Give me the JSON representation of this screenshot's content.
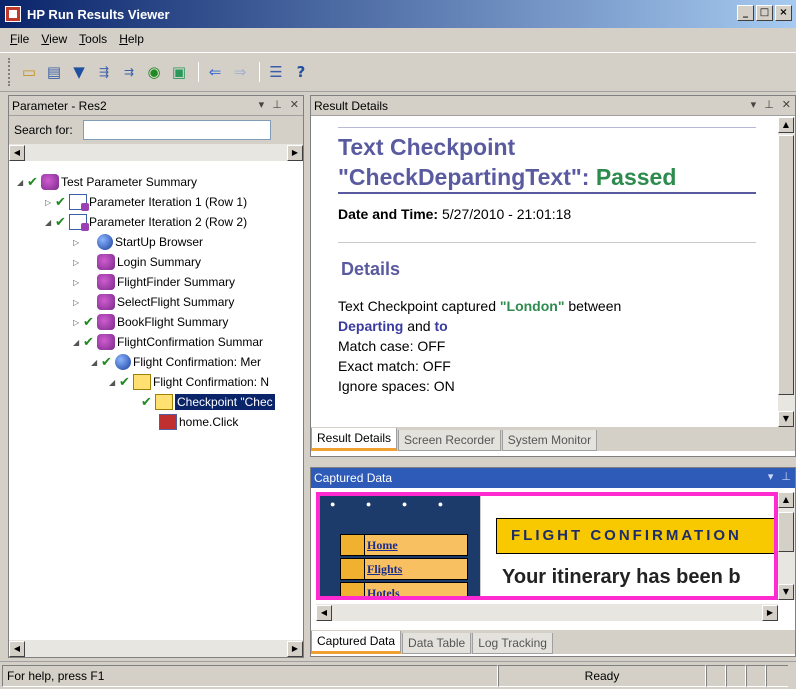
{
  "window": {
    "title": "HP Run Results Viewer",
    "buttons": [
      "_",
      "□",
      "×"
    ]
  },
  "menu": [
    {
      "label": "File",
      "key": "F",
      "rest": "ile"
    },
    {
      "label": "View",
      "key": "V",
      "rest": "iew"
    },
    {
      "label": "Tools",
      "key": "T",
      "rest": "ools"
    },
    {
      "label": "Help",
      "key": "H",
      "rest": "elp"
    }
  ],
  "toolbar": {
    "icons": [
      "open-icon",
      "print-icon",
      "filter-icon",
      "tree-expand-icon",
      "tree-collapse-icon",
      "refresh-icon",
      "export-icon",
      "back-icon",
      "forward-icon",
      "list-icon",
      "help-icon"
    ]
  },
  "left_panel": {
    "title": "Parameter - Res2",
    "search_label": "Search for:",
    "search_value": "",
    "tree": [
      {
        "label": "Test Parameter Summary",
        "expander": "◢",
        "check": true,
        "icon": "summary"
      },
      {
        "label": "Parameter Iteration 1 (Row 1)",
        "expander": "▷",
        "check": true,
        "icon": "doc"
      },
      {
        "label": "Parameter Iteration 2 (Row 2)",
        "expander": "◢",
        "check": true,
        "icon": "doc"
      },
      {
        "label": "StartUp Browser",
        "expander": "▷",
        "check": false,
        "icon": "globe"
      },
      {
        "label": "Login Summary",
        "expander": "▷",
        "check": false,
        "icon": "summary"
      },
      {
        "label": "FlightFinder Summary",
        "expander": "▷",
        "check": false,
        "icon": "summary"
      },
      {
        "label": "SelectFlight Summary",
        "expander": "▷",
        "check": false,
        "icon": "summary"
      },
      {
        "label": "BookFlight Summary",
        "expander": "▷",
        "check": true,
        "icon": "summary"
      },
      {
        "label": "FlightConfirmation Summar",
        "expander": "◢",
        "check": true,
        "icon": "summary"
      },
      {
        "label": "Flight Confirmation: Mer",
        "expander": "◢",
        "check": true,
        "icon": "globe"
      },
      {
        "label": "Flight Confirmation: N",
        "expander": "◢",
        "check": true,
        "icon": "step"
      },
      {
        "label": "Checkpoint \"Chec",
        "expander": "",
        "check": true,
        "icon": "step",
        "selected": true
      },
      {
        "label": "home.Click",
        "expander": "",
        "check": false,
        "icon": "click"
      }
    ]
  },
  "result_panel": {
    "title": "Result Details",
    "heading_line1": "Text Checkpoint",
    "heading_line2": "\"CheckDepartingText\":",
    "status": "Passed",
    "date_label": "Date and Time:",
    "date_value": "5/27/2010 - 21:01:18",
    "details_heading": "Details",
    "captured_text_prefix": "Text Checkpoint  captured",
    "captured_value": "\"London\"",
    "between_word": "between",
    "from_word": "Departing",
    "and_word": "and",
    "to_word": "to",
    "match_case": "Match case: OFF",
    "exact_match": "Exact match: OFF",
    "ignore_spaces": "Ignore spaces: ON",
    "tabs": [
      "Result Details",
      "Screen Recorder",
      "System Monitor"
    ],
    "active_tab": 0
  },
  "captured_panel": {
    "title": "Captured Data",
    "image": {
      "nav_links": [
        "Home",
        "Flights",
        "Hotels"
      ],
      "banner": "FLIGHT CONFIRMATION",
      "message": "Your itinerary has been b"
    },
    "tabs": [
      "Captured Data",
      "Data Table",
      "Log Tracking"
    ],
    "active_tab": 0
  },
  "status_bar": {
    "help": "For help, press F1",
    "status": "Ready"
  },
  "colors": {
    "accent_highlight": "#ff2bd0",
    "passed": "#2e8b4e",
    "heading": "#5a5aa0",
    "tab_active": "#f0a030"
  }
}
